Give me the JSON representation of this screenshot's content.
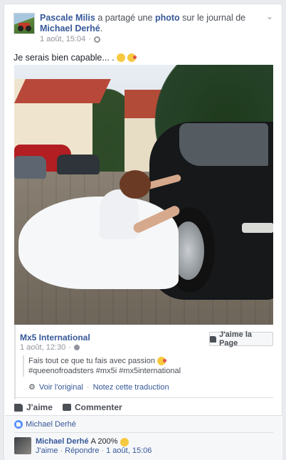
{
  "header": {
    "author": "Pascale Milis",
    "action_text": "a partagé une",
    "object_link": "photo",
    "action_text2": "sur le journal de",
    "target": "Michael Derhé",
    "timestamp": "1 août, 15:04",
    "privacy_sep": "·"
  },
  "post": {
    "text": "Je serais bien capable... ."
  },
  "shared_page": {
    "name": "Mx5 International",
    "timestamp": "1 août, 12:30",
    "privacy_sep": "·",
    "like_button_label": "J'aime la Page",
    "quote_line1": "Fais tout ce que tu fais avec passion",
    "quote_line2": "#queenofroadsters #mx5i #mx5international",
    "see_original": "Voir l'original",
    "sep": "·",
    "translate": "Notez cette traduction"
  },
  "actions": {
    "like": "J'aime",
    "comment": "Commenter"
  },
  "feedback": {
    "likers": "Michael Derhé"
  },
  "comment": {
    "author": "Michael Derhé",
    "text": "A 200%",
    "like": "J'aime",
    "sep": "·",
    "reply": "Répondre",
    "sep2": "·",
    "timestamp": "1 août, 15:06"
  },
  "icons": {
    "options": "chevron-down-icon",
    "privacy": "gear-icon",
    "page_privacy": "globe-icon",
    "like": "thumbs-up-icon",
    "comment": "speech-bubble-icon"
  },
  "colors": {
    "link": "#365899",
    "muted": "#90949c",
    "text": "#1d2129",
    "background": "#e9ebee",
    "reaction": "#5890ff"
  }
}
